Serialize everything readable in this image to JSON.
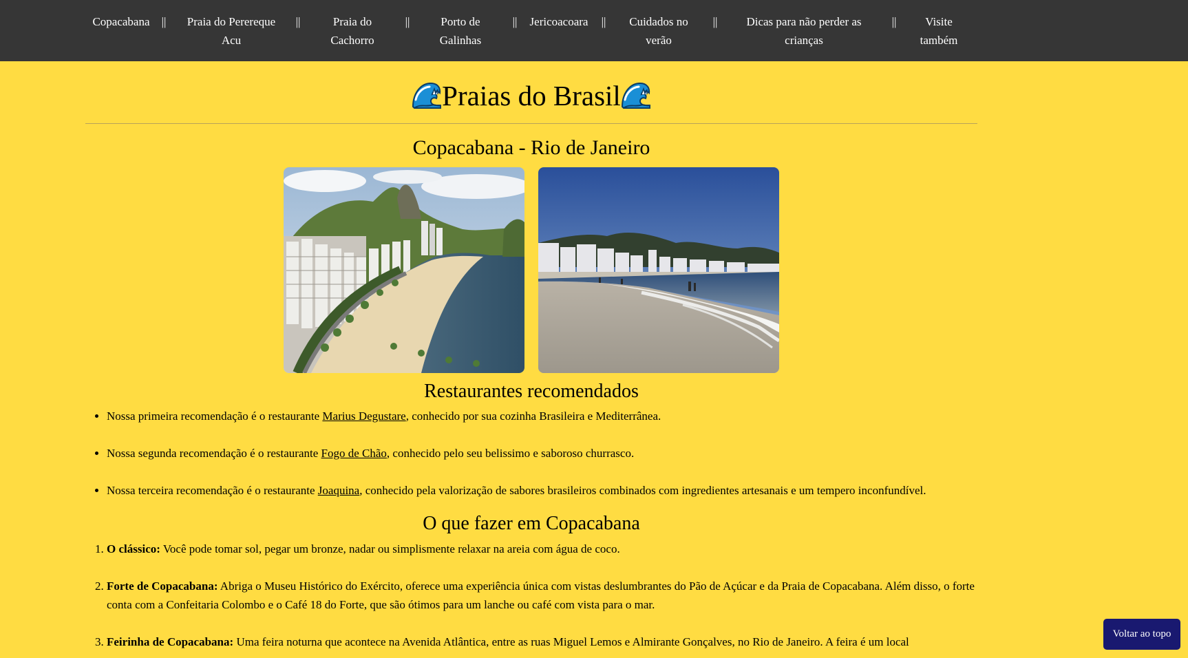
{
  "nav": {
    "items": [
      {
        "label": "Copacabana"
      },
      {
        "label": "Praia do Perereque Acu"
      },
      {
        "label": "Praia do Cachorro"
      },
      {
        "label": "Porto de Galinhas"
      },
      {
        "label": "Jericoacoara"
      },
      {
        "label": "Cuidados no verão"
      },
      {
        "label": "Dicas para não perder as crianças"
      },
      {
        "label": "Visite também"
      }
    ],
    "separator": "||"
  },
  "header": {
    "title": "Praias do Brasil",
    "icon": "wave-icon"
  },
  "beach": {
    "title": "Copacabana - Rio de Janeiro",
    "photos": [
      "copacabana-aerial-photo",
      "copacabana-shore-photo"
    ]
  },
  "restaurants": {
    "title": "Restaurantes recomendados",
    "items": [
      {
        "before": "Nossa primeira recomendação é o restaurante ",
        "link": "Marius Degustare",
        "after": ", conhecido por sua cozinha Brasileira e Mediterrânea."
      },
      {
        "before": "Nossa segunda recomendação é o restaurante ",
        "link": "Fogo de Chão",
        "after": ", conhecido pelo seu belissimo e saboroso churrasco."
      },
      {
        "before": "Nossa terceira recomendação é o restaurante ",
        "link": "Joaquina",
        "after": ", conhecido pela valorização de sabores brasileiros combinados com ingredientes artesanais e um tempero inconfundível."
      }
    ]
  },
  "activities": {
    "title": "O que fazer em Copacabana",
    "items": [
      {
        "heading": "O clássico:",
        "text": " Você pode tomar sol, pegar um bronze, nadar ou simplismente relaxar na areia com água de coco."
      },
      {
        "heading": "Forte de Copacabana:",
        "text": " Abriga o Museu Histórico do Exército, oferece uma experiência única com vistas deslumbrantes do Pão de Açúcar e da Praia de Copacabana. Além disso, o forte conta com a Confeitaria Colombo e o Café 18 do Forte, que são ótimos para um lanche ou café com vista para o mar."
      },
      {
        "heading": "Feirinha de Copacabana:",
        "text": " Uma feira noturna que acontece na Avenida Atlântica, entre as ruas Miguel Lemos e Almirante Gonçalves, no Rio de Janeiro. A feira é um local"
      }
    ]
  },
  "back_to_top": {
    "label": "Voltar ao topo"
  },
  "colors": {
    "page_bg": "#FFDC42",
    "nav_bg": "#363636",
    "nav_text": "#FFFFFF",
    "button_bg": "#191970"
  }
}
